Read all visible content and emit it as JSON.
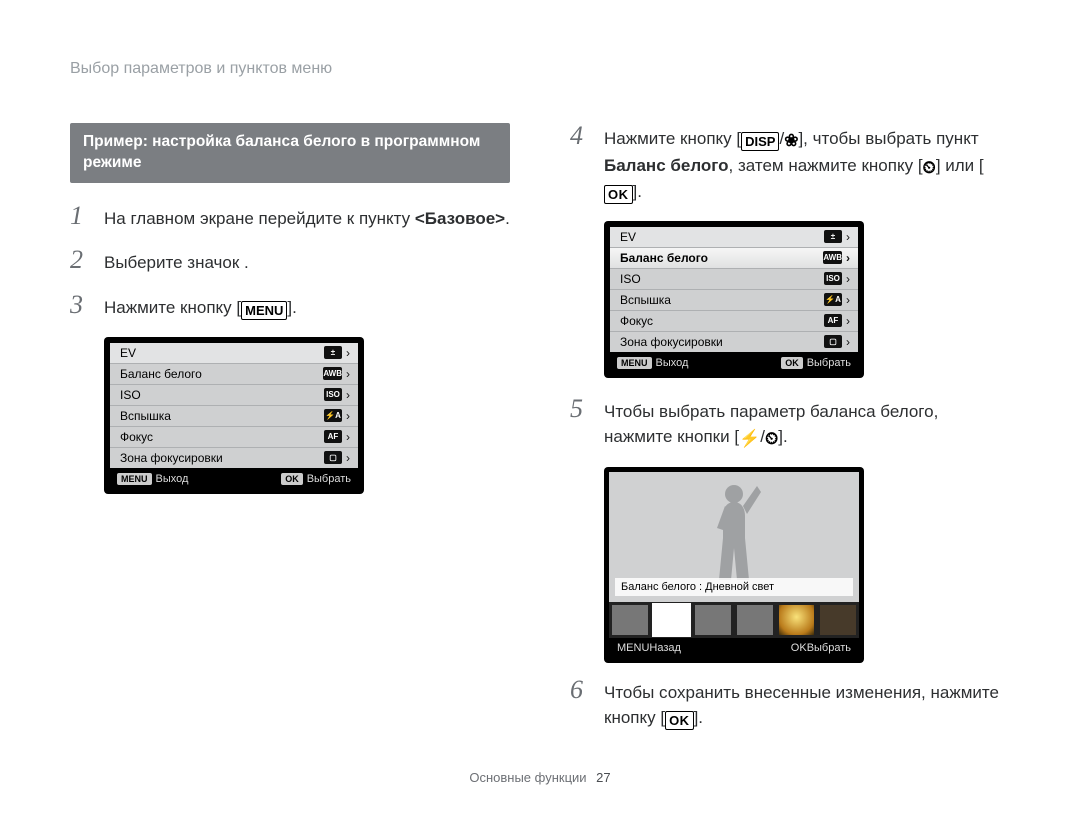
{
  "running_head": "Выбор параметров и пунктов меню",
  "banner": "Пример: настройка баланса белого в программном режиме",
  "left_steps": {
    "s1": {
      "num": "1",
      "before": "На главном экране перейдите к пункту ",
      "bold": "<Базовое>",
      "after": "."
    },
    "s2": {
      "num": "2",
      "text": "Выберите значок    ."
    },
    "s3": {
      "num": "3",
      "before": "Нажмите кнопку [",
      "key": "MENU",
      "after": "]."
    }
  },
  "menu_left": {
    "rows": [
      {
        "label": "EV",
        "icon": "±"
      },
      {
        "label": "Баланс белого",
        "icon": "AWB"
      },
      {
        "label": "ISO",
        "icon": "ISO"
      },
      {
        "label": "Вспышка",
        "icon": "⚡A"
      },
      {
        "label": "Фокус",
        "icon": "AF"
      },
      {
        "label": "Зона фокусировки",
        "icon": "▢"
      }
    ],
    "bar_left_btn": "MENU",
    "bar_left_lbl": "Выход",
    "bar_right_btn": "OK",
    "bar_right_lbl": "Выбрать"
  },
  "right_steps": {
    "s4": {
      "num": "4",
      "line1_before": "Нажмите кнопку [",
      "line1_sep": "/",
      "line1_after": "], чтобы выбрать пункт ",
      "bold": "Баланс белого",
      "line2_before": ", затем нажмите кнопку [",
      "or": "] или [",
      "line2_after": "]."
    },
    "s5": {
      "num": "5",
      "before": "Чтобы выбрать параметр баланса белого, нажмите кнопки [",
      "sep": "/",
      "after": "]."
    },
    "s6": {
      "num": "6",
      "before": "Чтобы сохранить внесенные изменения, нажмите кнопку [",
      "after": "]."
    }
  },
  "menu_right": {
    "selected_index": 1,
    "rows": [
      {
        "label": "EV",
        "icon": "±"
      },
      {
        "label": "Баланс белого",
        "icon": "AWB"
      },
      {
        "label": "ISO",
        "icon": "ISO"
      },
      {
        "label": "Вспышка",
        "icon": "⚡A"
      },
      {
        "label": "Фокус",
        "icon": "AF"
      },
      {
        "label": "Зона фокусировки",
        "icon": "▢"
      }
    ],
    "bar_left_btn": "MENU",
    "bar_left_lbl": "Выход",
    "bar_right_btn": "OK",
    "bar_right_lbl": "Выбрать"
  },
  "wb_preview": {
    "caption": "Баланс белого : Дневной свет",
    "bar_left_btn": "MENU",
    "bar_left_lbl": "Назад",
    "bar_right_btn": "OK",
    "bar_right_lbl": "Выбрать"
  },
  "footer": {
    "section": "Основные функции",
    "page": "27"
  },
  "keys": {
    "disp": "DISP",
    "menu": "MENU",
    "ok": "OK"
  },
  "glyphs": {
    "macro": "❀",
    "timer": "⏲",
    "flash": "⚡"
  }
}
